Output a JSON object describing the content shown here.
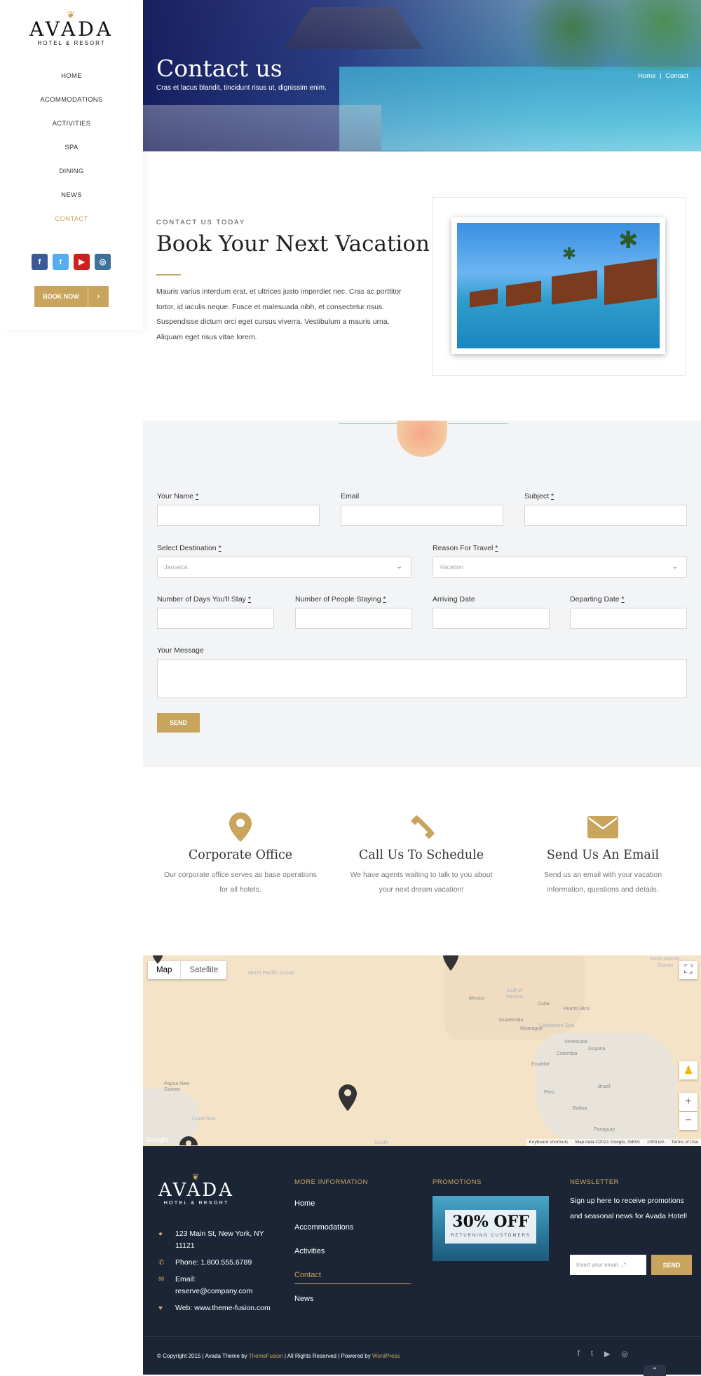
{
  "brand": {
    "name": "AVADA",
    "tagline": "HOTEL & RESORT",
    "accent": "#c9a45c",
    "dark": "#1b2536"
  },
  "nav": {
    "items": [
      {
        "label": "HOME"
      },
      {
        "label": "ACOMMODATIONS"
      },
      {
        "label": "ACTIVITIES"
      },
      {
        "label": "SPA"
      },
      {
        "label": "DINING"
      },
      {
        "label": "NEWS"
      },
      {
        "label": "CONTACT",
        "active": true
      }
    ],
    "social": [
      {
        "icon": "facebook-icon",
        "glyph": "f",
        "color": "#3b5998"
      },
      {
        "icon": "twitter-icon",
        "glyph": "t",
        "color": "#55acee"
      },
      {
        "icon": "youtube-icon",
        "glyph": "▶",
        "color": "#cd201f"
      },
      {
        "icon": "instagram-icon",
        "glyph": "◎",
        "color": "#3f729b"
      }
    ],
    "book_label": "BOOK NOW",
    "book_arrow": "›"
  },
  "hero": {
    "title": "Contact us",
    "subtitle": "Cras et lacus blandit, tincidunt risus ut, dignissim enim.",
    "breadcrumb_home": "Home",
    "breadcrumb_sep": "|",
    "breadcrumb_current": "Contact"
  },
  "intro": {
    "eyebrow": "CONTACT US TODAY",
    "title": "Book Your Next Vacation!",
    "body": "Mauris varius interdum erat, et ultrices justo imperdiet nec. Cras ac porttitor tortor, id iaculis neque. Fusce et malesuada nibh, et consectetur risus. Suspendisse dictum orci eget cursus viverra. Vestibulum a mauris urna. Aliquam eget risus vitae lorem."
  },
  "form": {
    "name_label": "Your Name",
    "email_label": "Email",
    "subject_label": "Subject",
    "destination_label": "Select Destination",
    "destination_value": "Jamaica",
    "reason_label": "Reason For Travel",
    "reason_value": "Vacation",
    "days_label": "Number of Days You'll Stay",
    "people_label": "Number of People Staying",
    "arriving_label": "Arriving Date",
    "departing_label": "Departing Date",
    "message_label": "Your Message",
    "required_mark": "*",
    "chevron": "⌄",
    "send_label": "SEND"
  },
  "features": [
    {
      "icon": "map-pin-icon",
      "title": "Corporate Office",
      "text": "Our corporate office serves as base operations for all hotels."
    },
    {
      "icon": "phone-icon",
      "title": "Call Us To Schedule",
      "text": "We have agents waiting to talk to you about your next dream vacation!"
    },
    {
      "icon": "envelope-icon",
      "title": "Send Us An Email",
      "text": "Send us an email with your vacation information, questions and details."
    }
  ],
  "map": {
    "tab_map": "Map",
    "tab_satellite": "Satellite",
    "labels": {
      "north_pacific": "North Pacific Ocean",
      "north_atlantic": "North Atlantic Ocean",
      "mexico": "Mexico",
      "gulf": "Gulf of Mexico",
      "cuba": "Cuba",
      "puerto_rico": "Puerto Rico",
      "guatemala": "Guatemala",
      "nicaragua": "Nicaragua",
      "caribbean": "Caribbean Sea",
      "venezuela": "Venezuela",
      "guyana": "Guyana",
      "colombia": "Colombia",
      "ecuador": "Ecuador",
      "peru": "Peru",
      "brazil": "Brazil",
      "bolivia": "Bolivia",
      "paraguay": "Paraguay",
      "png": "Papua New Guinea",
      "coral": "Coral Sea",
      "south": "South"
    },
    "footer_shortcuts": "Keyboard shortcuts",
    "footer_data": "Map data ©2021 Google, INEGI",
    "footer_scale": "1000 km",
    "footer_terms": "Terms of Use",
    "google": "Google",
    "zoom_in": "+",
    "zoom_out": "−",
    "fullscreen": "⛶"
  },
  "footer": {
    "logo_name": "AVADA",
    "logo_sub": "HOTEL & RESORT",
    "contact": [
      {
        "icon": "map-pin-icon",
        "glyph": "●",
        "text": "123 Main St, New York, NY 11121"
      },
      {
        "icon": "phone-icon",
        "glyph": "✆",
        "text": "Phone: 1.800.555.6789"
      },
      {
        "icon": "envelope-icon",
        "glyph": "✉",
        "text": "Email: reserve@company.com"
      },
      {
        "icon": "heart-icon",
        "glyph": "♥",
        "text": "Web: www.theme-fusion.com"
      }
    ],
    "more_heading": "MORE INFORMATION",
    "links": [
      {
        "label": "Home"
      },
      {
        "label": "Accommodations"
      },
      {
        "label": "Activities"
      },
      {
        "label": "Contact",
        "active": true
      },
      {
        "label": "News"
      }
    ],
    "promo_heading": "PROMOTIONS",
    "promo_big": "30% OFF",
    "promo_small": "RETURNING CUSTOMERS",
    "news_heading": "NEWSLETTER",
    "news_text": "Sign up here to receive promotions and seasonal news for Avada Hotel!",
    "news_placeholder": "Insert your email ...*",
    "news_send": "SEND"
  },
  "copyright": {
    "pre": "© Copyright 2015 | Avada Theme by ",
    "themefusion": "ThemeFusion",
    "mid": " | All Rights Reserved | Powered by ",
    "wordpress": "WordPress",
    "social": [
      "f",
      "t",
      "▶",
      "◎"
    ],
    "to_top": "⌃"
  }
}
